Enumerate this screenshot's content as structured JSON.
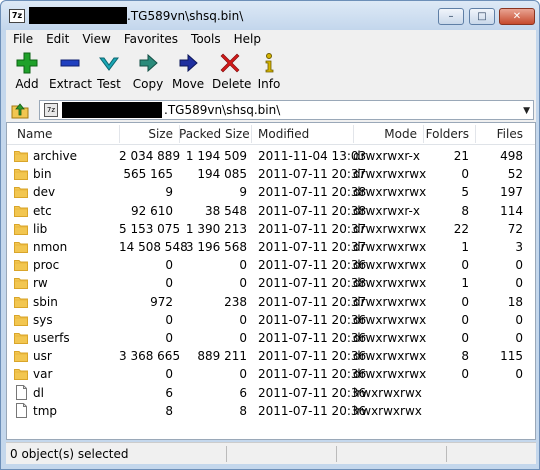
{
  "window": {
    "title": ".TG589vn\\shsq.bin\\",
    "minimize": "–",
    "maximize": "□",
    "close": "✕",
    "app_icon": "7z"
  },
  "menu": [
    "File",
    "Edit",
    "View",
    "Favorites",
    "Tools",
    "Help"
  ],
  "toolbar": {
    "items": [
      {
        "label": "Add",
        "icon": "add-icon",
        "color": "#1fa12a"
      },
      {
        "label": "Extract",
        "icon": "extract-icon",
        "color": "#1f3fbf"
      },
      {
        "label": "Test",
        "icon": "test-icon",
        "color": "#1aa7b5"
      },
      {
        "label": "Copy",
        "icon": "copy-icon",
        "color": "#2a8a7a"
      },
      {
        "label": "Move",
        "icon": "move-icon",
        "color": "#1f2f9f"
      },
      {
        "label": "Delete",
        "icon": "delete-icon",
        "color": "#d11a1a"
      },
      {
        "label": "Info",
        "icon": "info-icon",
        "color": "#d6b400"
      }
    ]
  },
  "address": {
    "path": ".TG589vn\\shsq.bin\\",
    "dropdown": "▼"
  },
  "columns": [
    "Name",
    "Size",
    "Packed Size",
    "Modified",
    "Mode",
    "Folders",
    "Files"
  ],
  "rows": [
    {
      "type": "folder",
      "name": "archive",
      "size": "2 034 889",
      "packed": "1 194 509",
      "modified": "2011-11-04 13:03",
      "mode": "drwxrwxr-x",
      "folders": "21",
      "files": "498"
    },
    {
      "type": "folder",
      "name": "bin",
      "size": "565 165",
      "packed": "194 085",
      "modified": "2011-07-11 20:37",
      "mode": "drwxrwxrwx",
      "folders": "0",
      "files": "52"
    },
    {
      "type": "folder",
      "name": "dev",
      "size": "9",
      "packed": "9",
      "modified": "2011-07-11 20:38",
      "mode": "drwxrwxrwx",
      "folders": "5",
      "files": "197"
    },
    {
      "type": "folder",
      "name": "etc",
      "size": "92 610",
      "packed": "38 548",
      "modified": "2011-07-11 20:38",
      "mode": "drwxrwxr-x",
      "folders": "8",
      "files": "114"
    },
    {
      "type": "folder",
      "name": "lib",
      "size": "5 153 075",
      "packed": "1 390 213",
      "modified": "2011-07-11 20:37",
      "mode": "drwxrwxrwx",
      "folders": "22",
      "files": "72"
    },
    {
      "type": "folder",
      "name": "nmon",
      "size": "14 508 548",
      "packed": "3 196 568",
      "modified": "2011-07-11 20:37",
      "mode": "drwxrwxrwx",
      "folders": "1",
      "files": "3"
    },
    {
      "type": "folder",
      "name": "proc",
      "size": "0",
      "packed": "0",
      "modified": "2011-07-11 20:36",
      "mode": "drwxrwxrwx",
      "folders": "0",
      "files": "0"
    },
    {
      "type": "folder",
      "name": "rw",
      "size": "0",
      "packed": "0",
      "modified": "2011-07-11 20:38",
      "mode": "drwxrwxrwx",
      "folders": "1",
      "files": "0"
    },
    {
      "type": "folder",
      "name": "sbin",
      "size": "972",
      "packed": "238",
      "modified": "2011-07-11 20:37",
      "mode": "drwxrwxrwx",
      "folders": "0",
      "files": "18"
    },
    {
      "type": "folder",
      "name": "sys",
      "size": "0",
      "packed": "0",
      "modified": "2011-07-11 20:36",
      "mode": "drwxrwxrwx",
      "folders": "0",
      "files": "0"
    },
    {
      "type": "folder",
      "name": "userfs",
      "size": "0",
      "packed": "0",
      "modified": "2011-07-11 20:36",
      "mode": "drwxrwxrwx",
      "folders": "0",
      "files": "0"
    },
    {
      "type": "folder",
      "name": "usr",
      "size": "3 368 665",
      "packed": "889 211",
      "modified": "2011-07-11 20:36",
      "mode": "drwxrwxrwx",
      "folders": "8",
      "files": "115"
    },
    {
      "type": "folder",
      "name": "var",
      "size": "0",
      "packed": "0",
      "modified": "2011-07-11 20:36",
      "mode": "drwxrwxrwx",
      "folders": "0",
      "files": "0"
    },
    {
      "type": "file",
      "name": "dl",
      "size": "6",
      "packed": "6",
      "modified": "2011-07-11 20:36",
      "mode": "lrwxrwxrwx",
      "folders": "",
      "files": ""
    },
    {
      "type": "file",
      "name": "tmp",
      "size": "8",
      "packed": "8",
      "modified": "2011-07-11 20:36",
      "mode": "lrwxrwxrwx",
      "folders": "",
      "files": ""
    }
  ],
  "status": {
    "selection": "0 object(s) selected"
  },
  "colors": {
    "folder": "#f2c650",
    "folder_dark": "#d9a52a",
    "title_bg": "#c4d7ec",
    "close": "#c64a2d"
  }
}
